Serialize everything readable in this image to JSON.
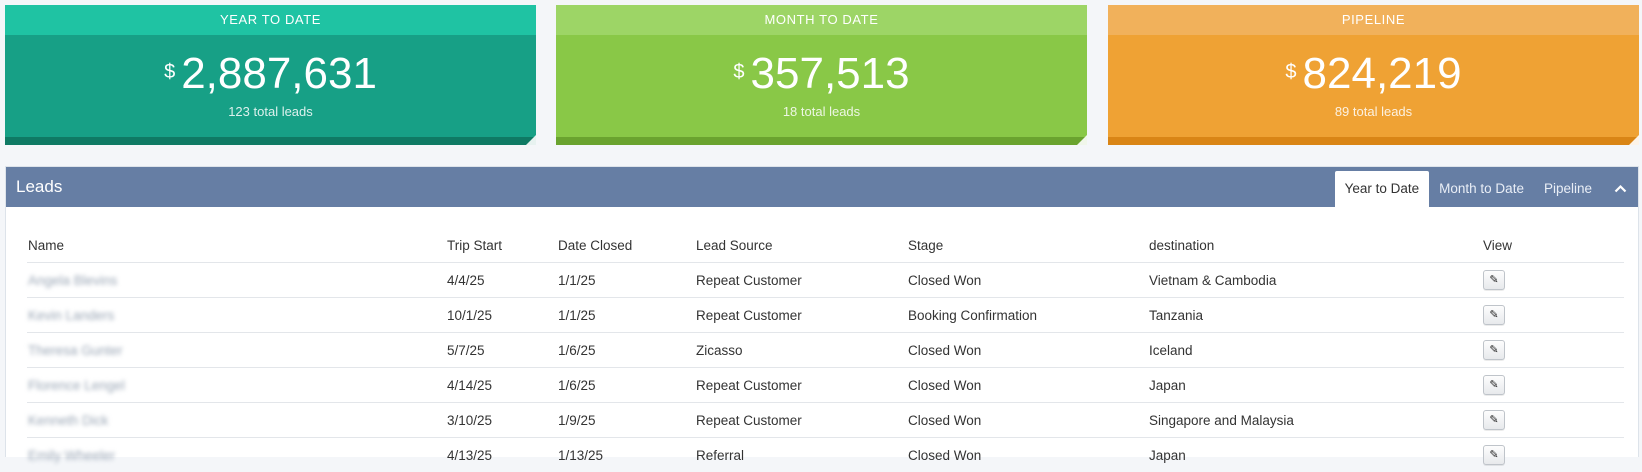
{
  "cards": {
    "ytd": {
      "title": "YEAR TO DATE",
      "currency": "$",
      "amount": "2,887,631",
      "sub": "123 total leads"
    },
    "mtd": {
      "title": "MONTH TO DATE",
      "currency": "$",
      "amount": "357,513",
      "sub": "18 total leads"
    },
    "pipeline": {
      "title": "PIPELINE",
      "currency": "$",
      "amount": "824,219",
      "sub": "89 total leads"
    }
  },
  "panel": {
    "title": "Leads",
    "tabs": [
      "Year to Date",
      "Month to Date",
      "Pipeline"
    ],
    "collapse_icon": "chevron-up-icon"
  },
  "table": {
    "headers": [
      "Name",
      "Trip Start",
      "Date Closed",
      "Lead Source",
      "Stage",
      "destination",
      "View"
    ],
    "rows": [
      {
        "name": "Angela Blevins",
        "trip_start": "4/4/25",
        "date_closed": "1/1/25",
        "lead_source": "Repeat Customer",
        "stage": "Closed Won",
        "destination": "Vietnam & Cambodia"
      },
      {
        "name": "Kevin Landers",
        "trip_start": "10/1/25",
        "date_closed": "1/1/25",
        "lead_source": "Repeat Customer",
        "stage": "Booking Confirmation",
        "destination": "Tanzania"
      },
      {
        "name": "Theresa Gunter",
        "trip_start": "5/7/25",
        "date_closed": "1/6/25",
        "lead_source": "Zicasso",
        "stage": "Closed Won",
        "destination": "Iceland"
      },
      {
        "name": "Florence Lengel",
        "trip_start": "4/14/25",
        "date_closed": "1/6/25",
        "lead_source": "Repeat Customer",
        "stage": "Closed Won",
        "destination": "Japan"
      },
      {
        "name": "Kenneth Dick",
        "trip_start": "3/10/25",
        "date_closed": "1/9/25",
        "lead_source": "Repeat Customer",
        "stage": "Closed Won",
        "destination": "Singapore and Malaysia"
      },
      {
        "name": "Emily Wheeler",
        "trip_start": "4/13/25",
        "date_closed": "1/13/25",
        "lead_source": "Referral",
        "stage": "Closed Won",
        "destination": "Japan"
      }
    ],
    "view_icon": "pencil-icon"
  }
}
